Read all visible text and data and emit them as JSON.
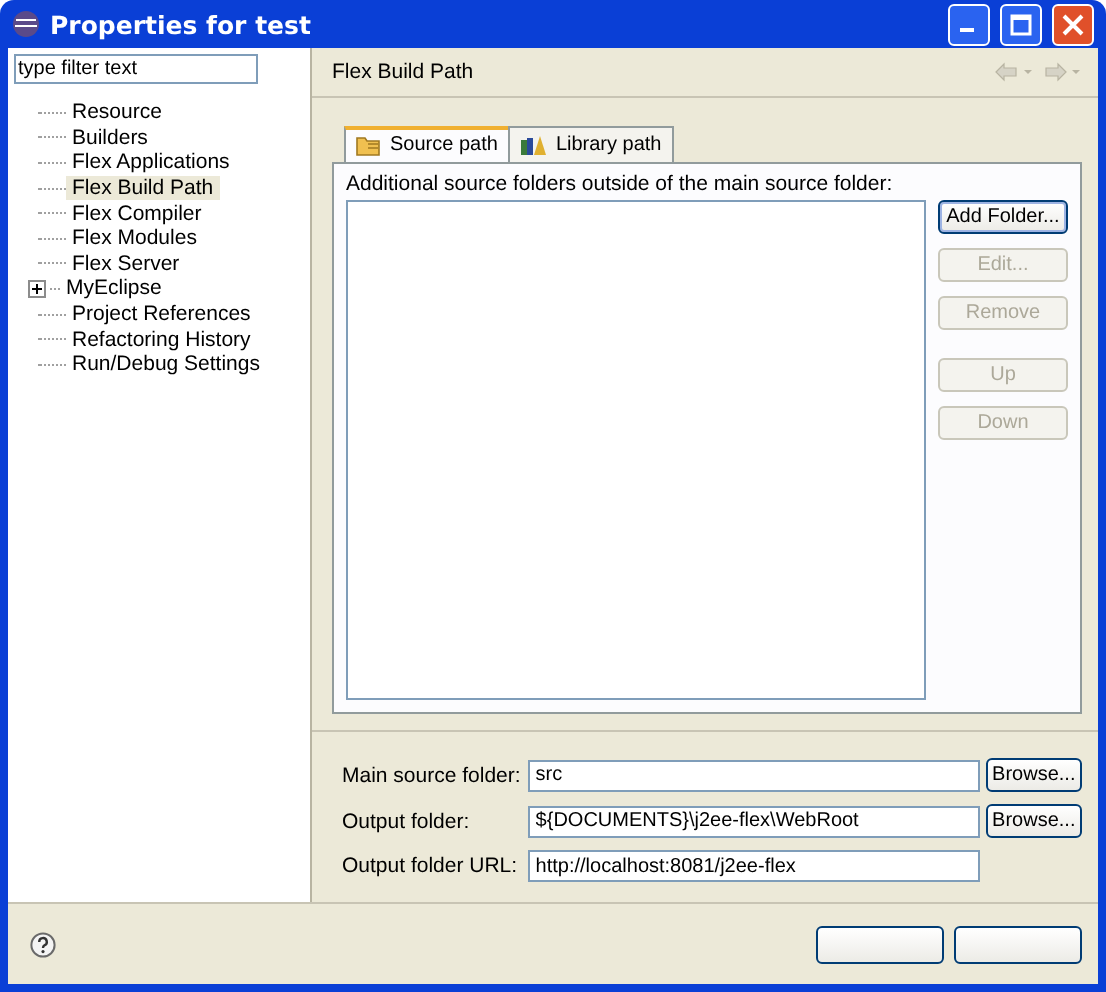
{
  "window": {
    "title": "Properties for test"
  },
  "sidebar": {
    "filter": {
      "value": "type filter text"
    },
    "items": [
      {
        "label": "Resource",
        "selected": false
      },
      {
        "label": "Builders",
        "selected": false
      },
      {
        "label": "Flex Applications",
        "selected": false
      },
      {
        "label": "Flex Build Path",
        "selected": true
      },
      {
        "label": "Flex Compiler",
        "selected": false
      },
      {
        "label": "Flex Modules",
        "selected": false
      },
      {
        "label": "Flex Server",
        "selected": false
      },
      {
        "label": "MyEclipse",
        "selected": false,
        "expanded": false
      },
      {
        "label": "Project References",
        "selected": false
      },
      {
        "label": "Refactoring History",
        "selected": false
      },
      {
        "label": "Run/Debug Settings",
        "selected": false
      }
    ]
  },
  "page": {
    "title": "Flex Build Path",
    "tabs": [
      {
        "label": "Source path",
        "selected": true
      },
      {
        "label": "Library path",
        "selected": false
      }
    ],
    "list_label": "Additional source folders outside of the main source folder:",
    "button_groups": [
      [
        {
          "label": "Add Folder...",
          "disabled": false
        },
        {
          "label": "Edit...",
          "disabled": true
        },
        {
          "label": "Remove",
          "disabled": true
        }
      ],
      [
        {
          "label": "Up",
          "disabled": true
        },
        {
          "label": "Down",
          "disabled": true
        }
      ]
    ],
    "fields": [
      {
        "label": "Main source folder:",
        "value": "src",
        "button": "Browse..."
      },
      {
        "label": "Output folder:",
        "value": "${DOCUMENTS}\\j2ee-flex\\WebRoot",
        "button": "Browse..."
      },
      {
        "label": "Output folder URL:",
        "value": "http://localhost:8081/j2ee-flex"
      }
    ]
  }
}
